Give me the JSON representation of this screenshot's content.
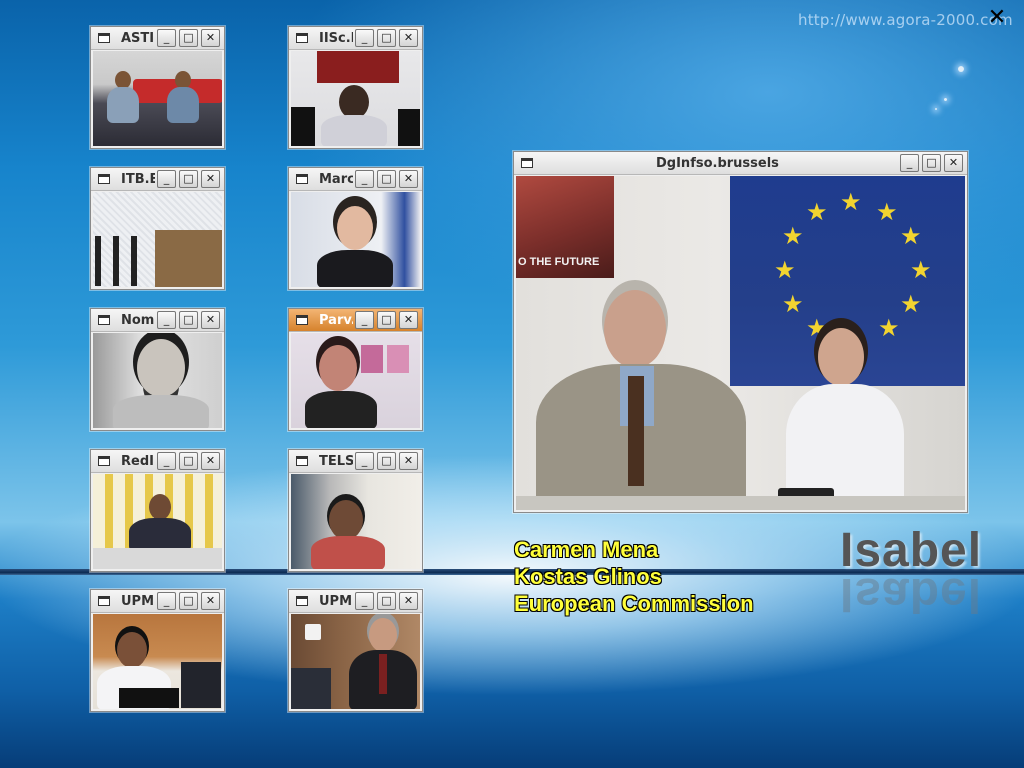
{
  "overlay": {
    "url": "http://www.agora-2000.com",
    "brand": "Isabel"
  },
  "captions": [
    "Carmen Mena",
    "Kostas Glinos",
    "European Commission"
  ],
  "windows": [
    {
      "id": "asti",
      "title": "ASTI"
    },
    {
      "id": "iisc",
      "title": "IISc.I"
    },
    {
      "id": "itb",
      "title": "ITB.E"
    },
    {
      "id": "marc",
      "title": "Marc"
    },
    {
      "id": "nom",
      "title": "Nom"
    },
    {
      "id": "parv",
      "title": "Parv."
    },
    {
      "id": "redi",
      "title": "RedI"
    },
    {
      "id": "tels",
      "title": "TELS"
    },
    {
      "id": "upm1",
      "title": "UPM"
    },
    {
      "id": "upm2",
      "title": "UPM"
    },
    {
      "id": "dg",
      "title": "DgInfso.brussels"
    }
  ],
  "video_text": {
    "poster": "O THE FUTURE"
  },
  "controls": {
    "minimize": "_",
    "maximize": "□",
    "close": "✕"
  }
}
